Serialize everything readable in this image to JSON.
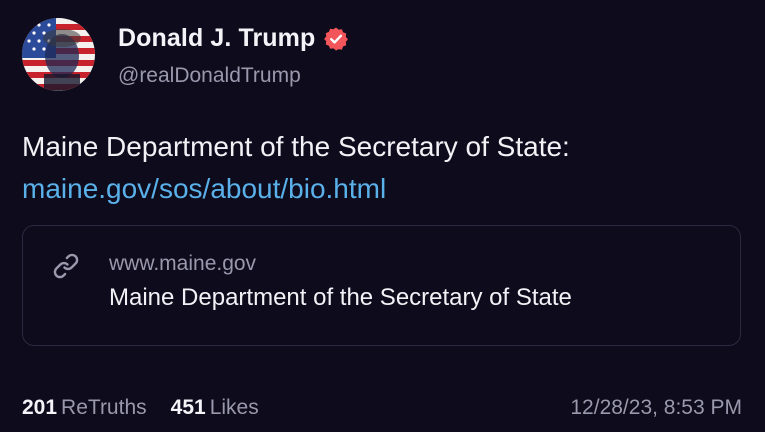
{
  "author": {
    "display_name": "Donald J. Trump",
    "handle": "@realDonaldTrump",
    "avatar_icon": "user-avatar",
    "verified_icon": "verified-badge-icon",
    "verified_color": "#f2555a"
  },
  "post": {
    "text": "Maine Department of the Secretary of State:",
    "link": "maine.gov/sos/about/bio.html",
    "link_color": "#5ab0e8"
  },
  "link_card": {
    "icon": "link-icon",
    "domain": "www.maine.gov",
    "title": "Maine Department of the Secretary of State"
  },
  "stats": {
    "retruths_count": "201",
    "retruths_label": "ReTruths",
    "likes_count": "451",
    "likes_label": "Likes"
  },
  "timestamp": "12/28/23, 8:53 PM",
  "colors": {
    "background": "#0d0b1c",
    "muted_text": "#9a98ac",
    "card_border": "#2c2a40"
  }
}
